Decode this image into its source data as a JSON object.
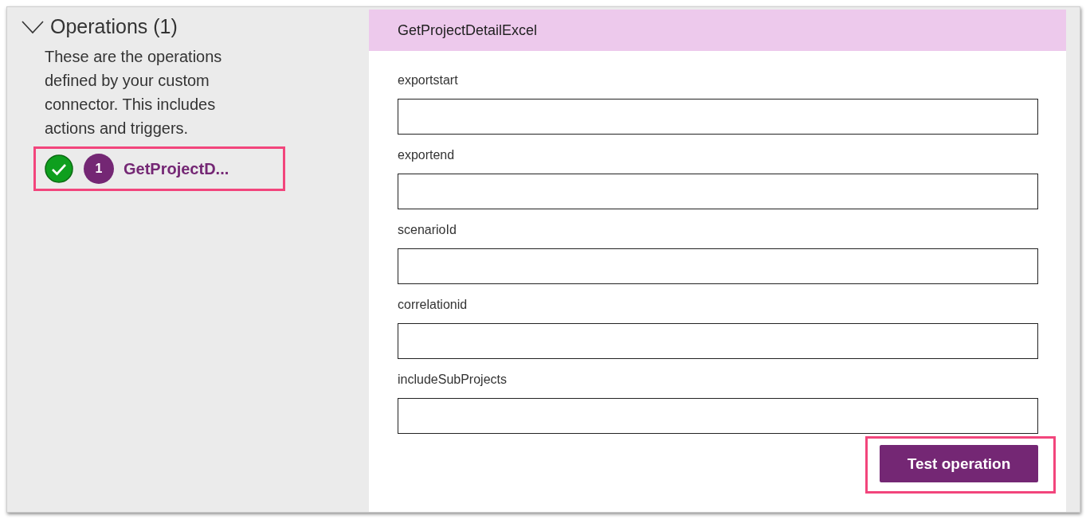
{
  "operations": {
    "title": "Operations (1)",
    "expanded": true,
    "description": "These are the operations defined by your custom connector. This includes actions and triggers.",
    "items": [
      {
        "number": "1",
        "label": "GetProjectD...",
        "valid": true,
        "highlighted": true
      }
    ]
  },
  "detail": {
    "title": "GetProjectDetailExcel",
    "fields": [
      {
        "label": "exportstart"
      },
      {
        "label": "exportend"
      },
      {
        "label": "scenarioId"
      },
      {
        "label": "correlationid"
      },
      {
        "label": "includeSubProjects"
      }
    ],
    "button": {
      "label": "Test operation",
      "highlighted": true
    }
  }
}
